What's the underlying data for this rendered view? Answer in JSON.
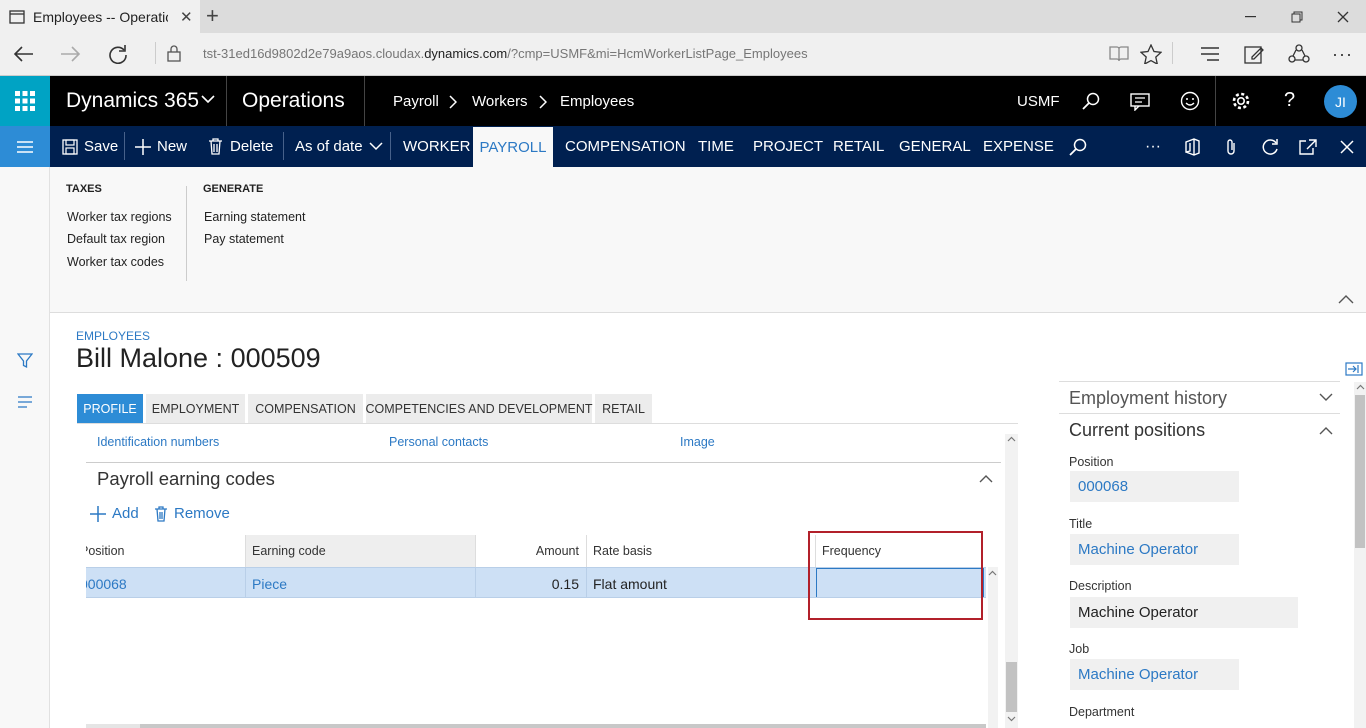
{
  "browser": {
    "tab_title": "Employees -- Operatior",
    "url_prefix": "tst-31ed16d9802d2e79a9aos.cloudax.",
    "url_domain": "dynamics.com",
    "url_suffix": "/?cmp=USMF&mi=HcmWorkerListPage_Employees"
  },
  "header": {
    "brand": "Dynamics 365",
    "app": "Operations",
    "breadcrumb": [
      "Payroll",
      "Workers",
      "Employees"
    ],
    "company": "USMF",
    "avatar": "JI"
  },
  "actionbar": {
    "save": "Save",
    "new": "New",
    "delete": "Delete",
    "as_of_date": "As of date",
    "tabs": [
      "WORKER",
      "PAYROLL",
      "COMPENSATION",
      "TIME",
      "PROJECT",
      "RETAIL",
      "GENERAL",
      "EXPENSE"
    ],
    "more": "···"
  },
  "ribbon": {
    "taxes": {
      "title": "TAXES",
      "items": [
        "Worker tax regions",
        "Default tax region",
        "Worker tax codes"
      ]
    },
    "generate": {
      "title": "GENERATE",
      "items": [
        "Earning statement",
        "Pay statement"
      ]
    }
  },
  "record": {
    "caption": "EMPLOYEES",
    "title": "Bill Malone : 000509",
    "tabs": [
      "PROFILE",
      "EMPLOYMENT",
      "COMPENSATION",
      "COMPETENCIES AND DEVELOPMENT",
      "RETAIL"
    ],
    "links": [
      "Identification numbers",
      "Personal contacts",
      "Image"
    ]
  },
  "section": {
    "title": "Payroll earning codes",
    "add": "Add",
    "remove": "Remove",
    "columns": [
      "Position",
      "Earning code",
      "Amount",
      "Rate basis",
      "Frequency"
    ],
    "row": {
      "position": "000068",
      "earning_code": "Piece",
      "amount": "0.15",
      "rate_basis": "Flat amount",
      "frequency": ""
    }
  },
  "factbox": {
    "employment_history": "Employment history",
    "current_positions": "Current positions",
    "position_label": "Position",
    "position_value": "000068",
    "title_label": "Title",
    "title_value": "Machine Operator",
    "description_label": "Description",
    "description_value": "Machine Operator",
    "job_label": "Job",
    "job_value": "Machine Operator",
    "department_label": "Department"
  },
  "colors": {
    "accent": "#2c79c4",
    "header": "#000000",
    "actionbar": "#002050",
    "waffle": "#00a3c4",
    "highlight_box": "#b2202a",
    "selected_row": "#cde0f5"
  }
}
